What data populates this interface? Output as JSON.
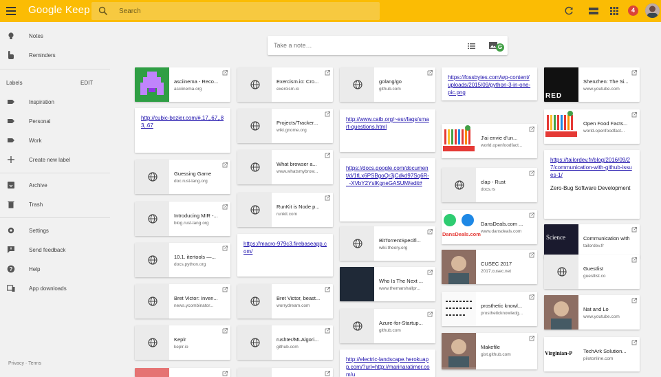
{
  "header": {
    "app_title": "Google Keep",
    "search_placeholder": "Search",
    "notification_count": "4",
    "colors": {
      "brand": "#fbbc04",
      "badge": "#db4437"
    }
  },
  "sidebar": {
    "items": [
      {
        "label": "Notes",
        "icon": "lightbulb-icon"
      },
      {
        "label": "Reminders",
        "icon": "reminder-hand-icon"
      }
    ],
    "labels_heading": "Labels",
    "labels_edit": "EDIT",
    "labels": [
      {
        "label": "Inspiration",
        "icon": "label-icon"
      },
      {
        "label": "Personal",
        "icon": "label-icon"
      },
      {
        "label": "Work",
        "icon": "label-icon"
      },
      {
        "label": "Create new label",
        "icon": "plus-icon"
      }
    ],
    "bottom": [
      {
        "label": "Archive",
        "icon": "archive-icon"
      },
      {
        "label": "Trash",
        "icon": "trash-icon"
      },
      {
        "label": "Settings",
        "icon": "gear-icon"
      },
      {
        "label": "Send feedback",
        "icon": "feedback-icon"
      },
      {
        "label": "Help",
        "icon": "help-icon"
      },
      {
        "label": "App downloads",
        "icon": "devices-icon"
      }
    ],
    "footer": {
      "privacy": "Privacy",
      "sep": "·",
      "terms": "Terms"
    }
  },
  "take_note": {
    "placeholder": "Take a note…",
    "g_badge": "G"
  },
  "columns": [
    {
      "notes": [
        {
          "kind": "link",
          "title": "asciinema - Reco...",
          "domain": "asciinema.org",
          "thumb": "asciinema"
        },
        {
          "kind": "url",
          "url": "http://cubic-bezier.com/#.17,.67,.83,.67"
        },
        {
          "kind": "link",
          "title": "Guessing Game",
          "domain": "doc.rust-lang.org"
        },
        {
          "kind": "link",
          "title": "Introducing MIR -...",
          "domain": "blog.rust-lang.org"
        },
        {
          "kind": "link",
          "title": "10.1. itertools —...",
          "domain": "docs.python.org"
        },
        {
          "kind": "link",
          "title": "Bret Victor: Inven...",
          "domain": "news.ycombinator..."
        },
        {
          "kind": "link",
          "title": "Keplr",
          "domain": "keplr.io"
        }
      ]
    },
    {
      "notes": [
        {
          "kind": "link",
          "title": "Exercism.io: Cro...",
          "domain": "exercism.io"
        },
        {
          "kind": "link",
          "title": "Projects/Tracker...",
          "domain": "wiki.gnome.org"
        },
        {
          "kind": "link",
          "title": "What browser a...",
          "domain": "www.whatsmybrow..."
        },
        {
          "kind": "link",
          "title": "RunKit is Node p...",
          "domain": "runkit.com"
        },
        {
          "kind": "url",
          "url": "https://macro-979c3.firebaseapp.com/"
        },
        {
          "kind": "link",
          "title": "Bret Victor, beast...",
          "domain": "worrydream.com"
        },
        {
          "kind": "link",
          "title": "rushter/MLAlgori...",
          "domain": "github.com"
        }
      ]
    },
    {
      "notes": [
        {
          "kind": "link",
          "title": "golang/go",
          "domain": "github.com"
        },
        {
          "kind": "url",
          "url": "http://www.catb.org/~esr/faqs/smart-questions.html"
        },
        {
          "kind": "url",
          "url": "https://docs.google.com/document/d/1tLx6PSBgoQr3jCdkd97Sq6R-_-XVbY2YslKgneGASUM/edit#"
        },
        {
          "kind": "link",
          "title": "BitTorrentSpecifi...",
          "domain": "wiki.theory.org"
        },
        {
          "kind": "link",
          "title": "Who Is The Next ...",
          "domain": "www.themarshallpr...",
          "thumb": "dark"
        },
        {
          "kind": "link",
          "title": "Azure-for-Startup...",
          "domain": "github.com"
        },
        {
          "kind": "url",
          "url": "http://electric-landscape.herokuapp.com/?url=http://marinaratimer.com/u"
        }
      ]
    },
    {
      "notes": [
        {
          "kind": "url",
          "url": "https://fossbytes.com/wp-content/uploads/2015/09/python-3-in-one-pic.png"
        },
        {
          "kind": "link",
          "title": "J'ai envie d'un...",
          "domain": "world.openfoodfact...",
          "thumb": "openfood"
        },
        {
          "kind": "link",
          "title": "clap - Rust",
          "domain": "docs.rs"
        },
        {
          "kind": "link",
          "title": "DansDeals.com ...",
          "domain": "www.dansdeals.com",
          "thumb": "dansdeals",
          "thumb_text": "DansDeals.com"
        },
        {
          "kind": "link",
          "title": "CUSEC 2017",
          "domain": "2017.cusec.net",
          "thumb": "photo"
        },
        {
          "kind": "link",
          "title": "prosthetic knowl...",
          "domain": "prostheticknowledg...",
          "thumb": "sketch"
        },
        {
          "kind": "link",
          "title": "Makefile",
          "domain": "gist.github.com",
          "thumb": "photo"
        }
      ]
    },
    {
      "notes": [
        {
          "kind": "link",
          "title": "Shenzhen: The Si...",
          "domain": "www.youtube.com",
          "thumb": "red",
          "thumb_text": "RED"
        },
        {
          "kind": "link",
          "title": "Open Food Facts...",
          "domain": "world.openfoodfact...",
          "thumb": "openfood"
        },
        {
          "kind": "urlbody",
          "url": "https://tailordev.fr/blog/2016/09/27/communication-with-github-issues-1/",
          "body": "Zero-Bug Software Development"
        },
        {
          "kind": "link",
          "title": "Communication with G...",
          "domain": "tailordev.fr",
          "thumb": "science",
          "thumb_text": "Science"
        },
        {
          "kind": "link",
          "title": "Guestlist",
          "domain": "guestlist.co"
        },
        {
          "kind": "link",
          "title": "Nat and Lo",
          "domain": "www.youtube.com",
          "thumb": "photo"
        },
        {
          "kind": "link",
          "title": "TechArk Solution...",
          "domain": "pilotonline.com",
          "thumb": "newspaper",
          "thumb_text": "Virginian-P"
        }
      ]
    }
  ]
}
